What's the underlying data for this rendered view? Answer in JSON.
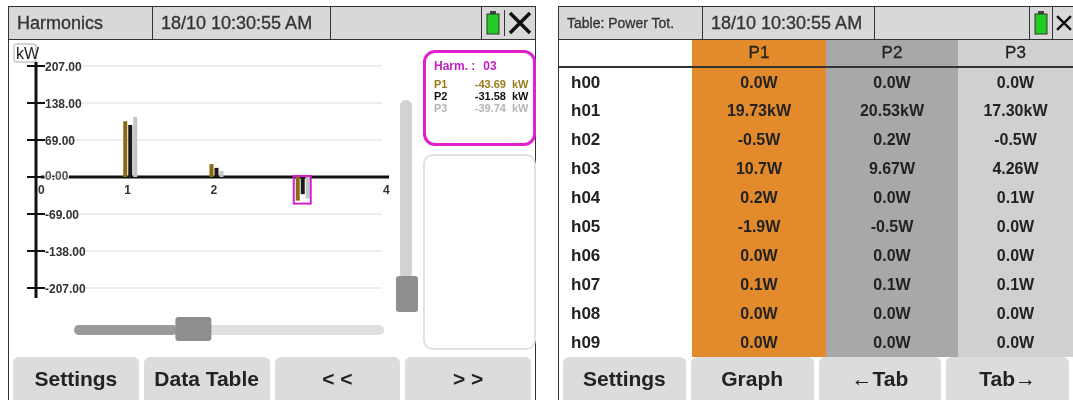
{
  "graph_screen": {
    "title": "Harmonics",
    "datetime": "18/10 10:30:55 AM",
    "chart_data": {
      "type": "bar",
      "ylabel": "kW",
      "x": [
        1,
        2,
        3
      ],
      "grid": true,
      "series": [
        {
          "color": "#8a6a12",
          "values": [
            104,
            24,
            -44
          ]
        },
        {
          "color": "#1a1a1a",
          "values": [
            97,
            17,
            -32
          ]
        },
        {
          "color": "#c4c4c4",
          "values": [
            112,
            11,
            -40
          ]
        }
      ],
      "xlim": [
        0,
        4
      ],
      "ylim": [
        -207,
        207
      ],
      "xticks": [
        0,
        1,
        2,
        4
      ],
      "yticks": [
        {
          "value": 207,
          "label": "207.00"
        },
        {
          "value": 138,
          "label": "138.00"
        },
        {
          "value": 69,
          "label": "69.00"
        },
        {
          "value": 0,
          "label": "0.00"
        },
        {
          "value": -69,
          "label": "-69.00"
        },
        {
          "value": -138,
          "label": "-138.00"
        },
        {
          "value": -207,
          "label": "-207.00"
        }
      ]
    },
    "horizontal_slider": {
      "level": 0.37
    },
    "vertical_slider": {
      "level": 1
    },
    "info": {
      "label": "Harm. :",
      "value": "03",
      "rows": [
        {
          "name": "P1",
          "value": "-43.69",
          "unit": "kW",
          "color": "#9a7a1a"
        },
        {
          "name": "P2",
          "value": "-31.58",
          "unit": "kW",
          "color": "#111111"
        },
        {
          "name": "P3",
          "value": "-39.74",
          "unit": "kW",
          "color": "#b4b4b4"
        }
      ]
    },
    "buttons": [
      "Settings",
      "Data Table",
      "< <",
      "> >"
    ]
  },
  "table_screen": {
    "title": "Table: Power Tot.",
    "datetime": "18/10 10:30:55 AM",
    "columns": [
      {
        "label": "P1",
        "color": "#e38b2c"
      },
      {
        "label": "P2",
        "color": "#a8a8a8"
      },
      {
        "label": "P3",
        "color": "#d0d0d0"
      }
    ],
    "rows": [
      {
        "label": "h00",
        "cells": [
          "0.0W",
          "0.0W",
          "0.0W"
        ]
      },
      {
        "label": "h01",
        "cells": [
          "19.73kW",
          "20.53kW",
          "17.30kW"
        ]
      },
      {
        "label": "h02",
        "cells": [
          "-0.5W",
          "0.2W",
          "-0.5W"
        ]
      },
      {
        "label": "h03",
        "cells": [
          "10.7W",
          "9.67W",
          "4.26W"
        ]
      },
      {
        "label": "h04",
        "cells": [
          "0.2W",
          "0.0W",
          "0.1W"
        ]
      },
      {
        "label": "h05",
        "cells": [
          "-1.9W",
          "-0.5W",
          "0.0W"
        ]
      },
      {
        "label": "h06",
        "cells": [
          "0.0W",
          "0.0W",
          "0.0W"
        ]
      },
      {
        "label": "h07",
        "cells": [
          "0.1W",
          "0.1W",
          "0.1W"
        ]
      },
      {
        "label": "h08",
        "cells": [
          "0.0W",
          "0.0W",
          "0.0W"
        ]
      },
      {
        "label": "h09",
        "cells": [
          "0.0W",
          "0.0W",
          "0.0W"
        ]
      }
    ],
    "buttons": [
      "Settings",
      "Graph",
      "←Tab",
      "Tab→"
    ]
  }
}
